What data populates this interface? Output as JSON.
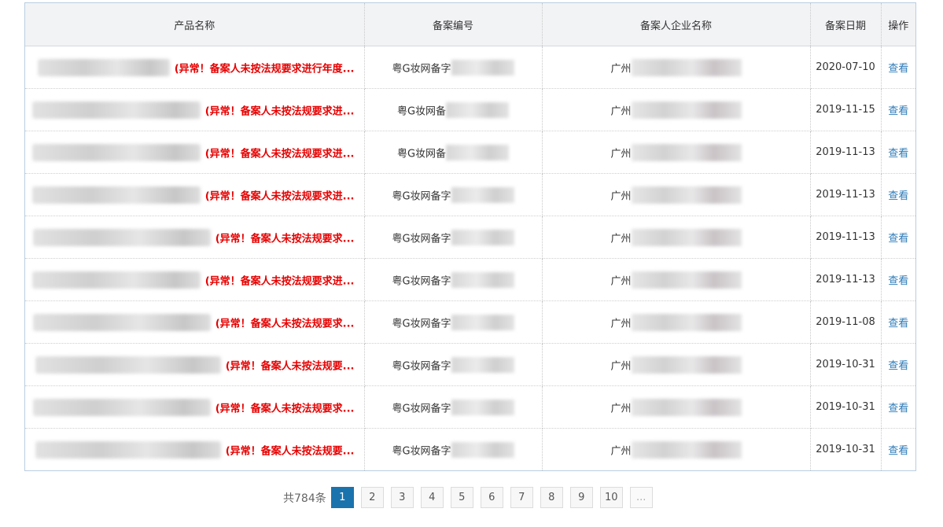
{
  "table": {
    "headers": {
      "name": "产品名称",
      "code": "备案编号",
      "enterprise": "备案人企业名称",
      "date": "备案日期",
      "op": "操作"
    },
    "rows": [
      {
        "warn": "(异常！备案人未按法规要求进行年度...",
        "code": "粤G妆网备字",
        "ent": "广州",
        "date": "2020-07-10",
        "op": "查看"
      },
      {
        "warn": "(异常！备案人未按法规要求进...",
        "code": "粤G妆网备",
        "ent": "广州",
        "date": "2019-11-15",
        "op": "查看"
      },
      {
        "warn": "(异常！备案人未按法规要求进...",
        "code": "粤G妆网备",
        "ent": "广州",
        "date": "2019-11-13",
        "op": "查看"
      },
      {
        "warn": "(异常！备案人未按法规要求进...",
        "code": "粤G妆网备字",
        "ent": "广州",
        "date": "2019-11-13",
        "op": "查看"
      },
      {
        "warn": "(异常！备案人未按法规要求...",
        "code": "粤G妆网备字",
        "ent": "广州",
        "date": "2019-11-13",
        "op": "查看"
      },
      {
        "warn": "(异常！备案人未按法规要求进...",
        "code": "粤G妆网备字",
        "ent": "广州",
        "date": "2019-11-13",
        "op": "查看"
      },
      {
        "warn": "(异常！备案人未按法规要求...",
        "code": "粤G妆网备字",
        "ent": "广州",
        "date": "2019-11-08",
        "op": "查看"
      },
      {
        "warn": "(异常！备案人未按法规要...",
        "code": "粤G妆网备字",
        "ent": "广州",
        "date": "2019-10-31",
        "op": "查看"
      },
      {
        "warn": "(异常！备案人未按法规要求...",
        "code": "粤G妆网备字",
        "ent": "广州",
        "date": "2019-10-31",
        "op": "查看"
      },
      {
        "warn": "(异常！备案人未按法规要...",
        "code": "粤G妆网备字",
        "ent": "广州",
        "date": "2019-10-31",
        "op": "查看"
      }
    ]
  },
  "pagination": {
    "total": "共784条",
    "pages": [
      "1",
      "2",
      "3",
      "4",
      "5",
      "6",
      "7",
      "8",
      "9",
      "10"
    ],
    "ellipsis": "...",
    "current": "1"
  },
  "colors": {
    "warning_text": "#e60000",
    "link": "#2d7bb8",
    "active_page": "#1a73ad"
  }
}
